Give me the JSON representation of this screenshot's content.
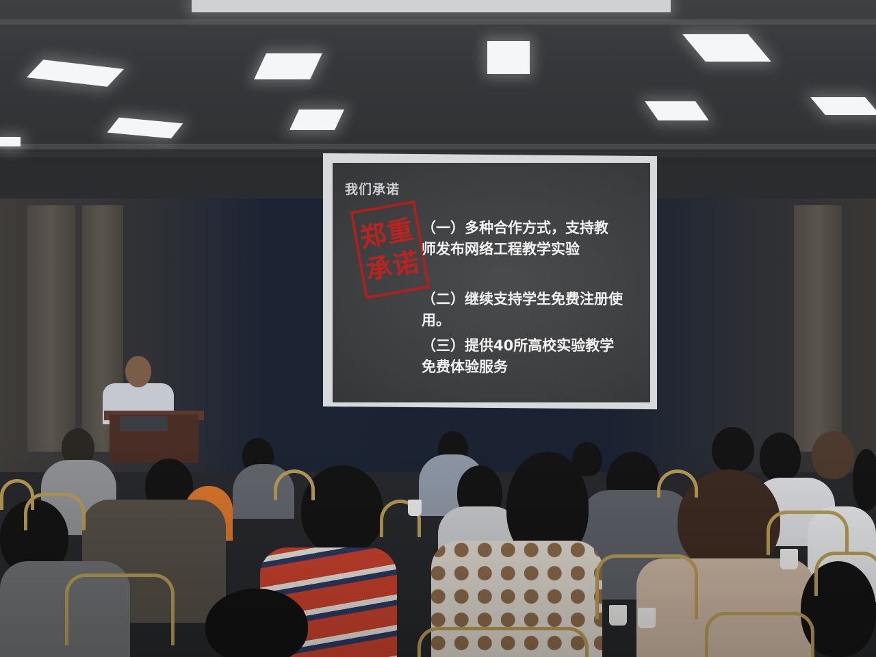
{
  "slide": {
    "title": "我们承诺",
    "stamp": {
      "line1": "郑重",
      "line2": "承诺",
      "color": "#c3231f"
    },
    "items": [
      {
        "line1": "（一）多种合作方式，支持教",
        "line2": "师发布网络工程教学实验"
      },
      {
        "line1": "（二）继续支持学生免费注册使",
        "line2": "用。"
      },
      {
        "line1": "（三）提供40所高校实验教学",
        "line2": "免费体验服务"
      }
    ]
  },
  "colors": {
    "slide_background": "#3c3d3f",
    "slide_text": "#f2f2f2",
    "stamp_red": "#b3201c"
  }
}
